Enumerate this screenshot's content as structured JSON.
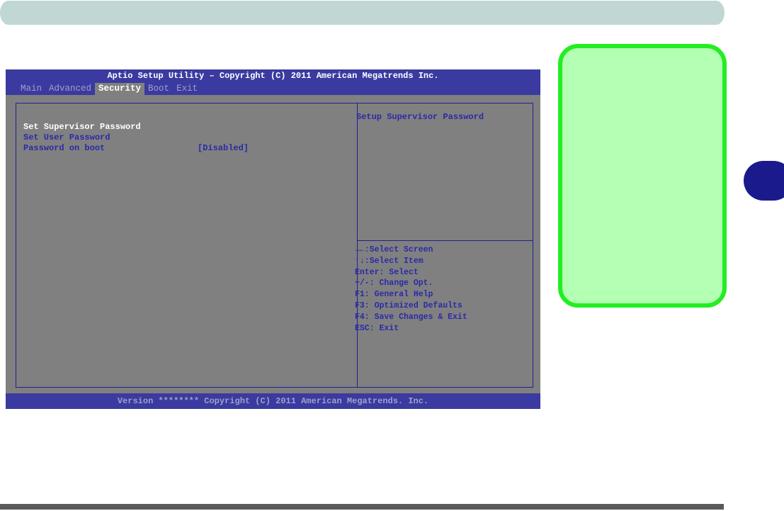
{
  "bios": {
    "title": "Aptio Setup Utility – Copyright (C) 2011 American Megatrends Inc.",
    "tabs": [
      "Main",
      "Advanced",
      "Security",
      "Boot",
      "Exit"
    ],
    "active_tab": "Security",
    "items": [
      {
        "label": "Set Supervisor Password",
        "value": ""
      },
      {
        "label": "Set User Password",
        "value": ""
      },
      {
        "label": "Password on boot",
        "value": "[Disabled]"
      }
    ],
    "help_text": "Setup Supervisor Password",
    "keys": [
      "→←:Select Screen",
      "↑↓:Select Item",
      "Enter: Select",
      "+/-: Change Opt.",
      "F1: General Help",
      "F3: Optimized Defaults",
      "F4: Save Changes & Exit",
      "ESC: Exit"
    ],
    "footer": "Version ******** Copyright (C) 2011 American Megatrends. Inc."
  }
}
